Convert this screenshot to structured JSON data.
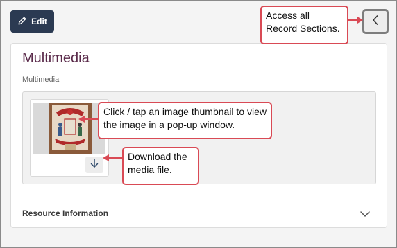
{
  "toolbar": {
    "edit_label": "Edit",
    "edit_icon": "pencil-icon",
    "sections_icon": "chevron-left-icon"
  },
  "card": {
    "title": "Multimedia",
    "subtitle": "Multimedia",
    "download_icon": "arrow-down-icon",
    "resource_label": "Resource Information",
    "resource_icon": "chevron-down-icon"
  },
  "callouts": {
    "sections": "Access all Record Sections.",
    "thumbnail": "Click / tap an image thumbnail to view the image in a pop-up window.",
    "download": "Download the media file."
  },
  "colors": {
    "edit_button": "#2b3a52",
    "title": "#5a2a4a",
    "callout_border": "#d94a55"
  }
}
